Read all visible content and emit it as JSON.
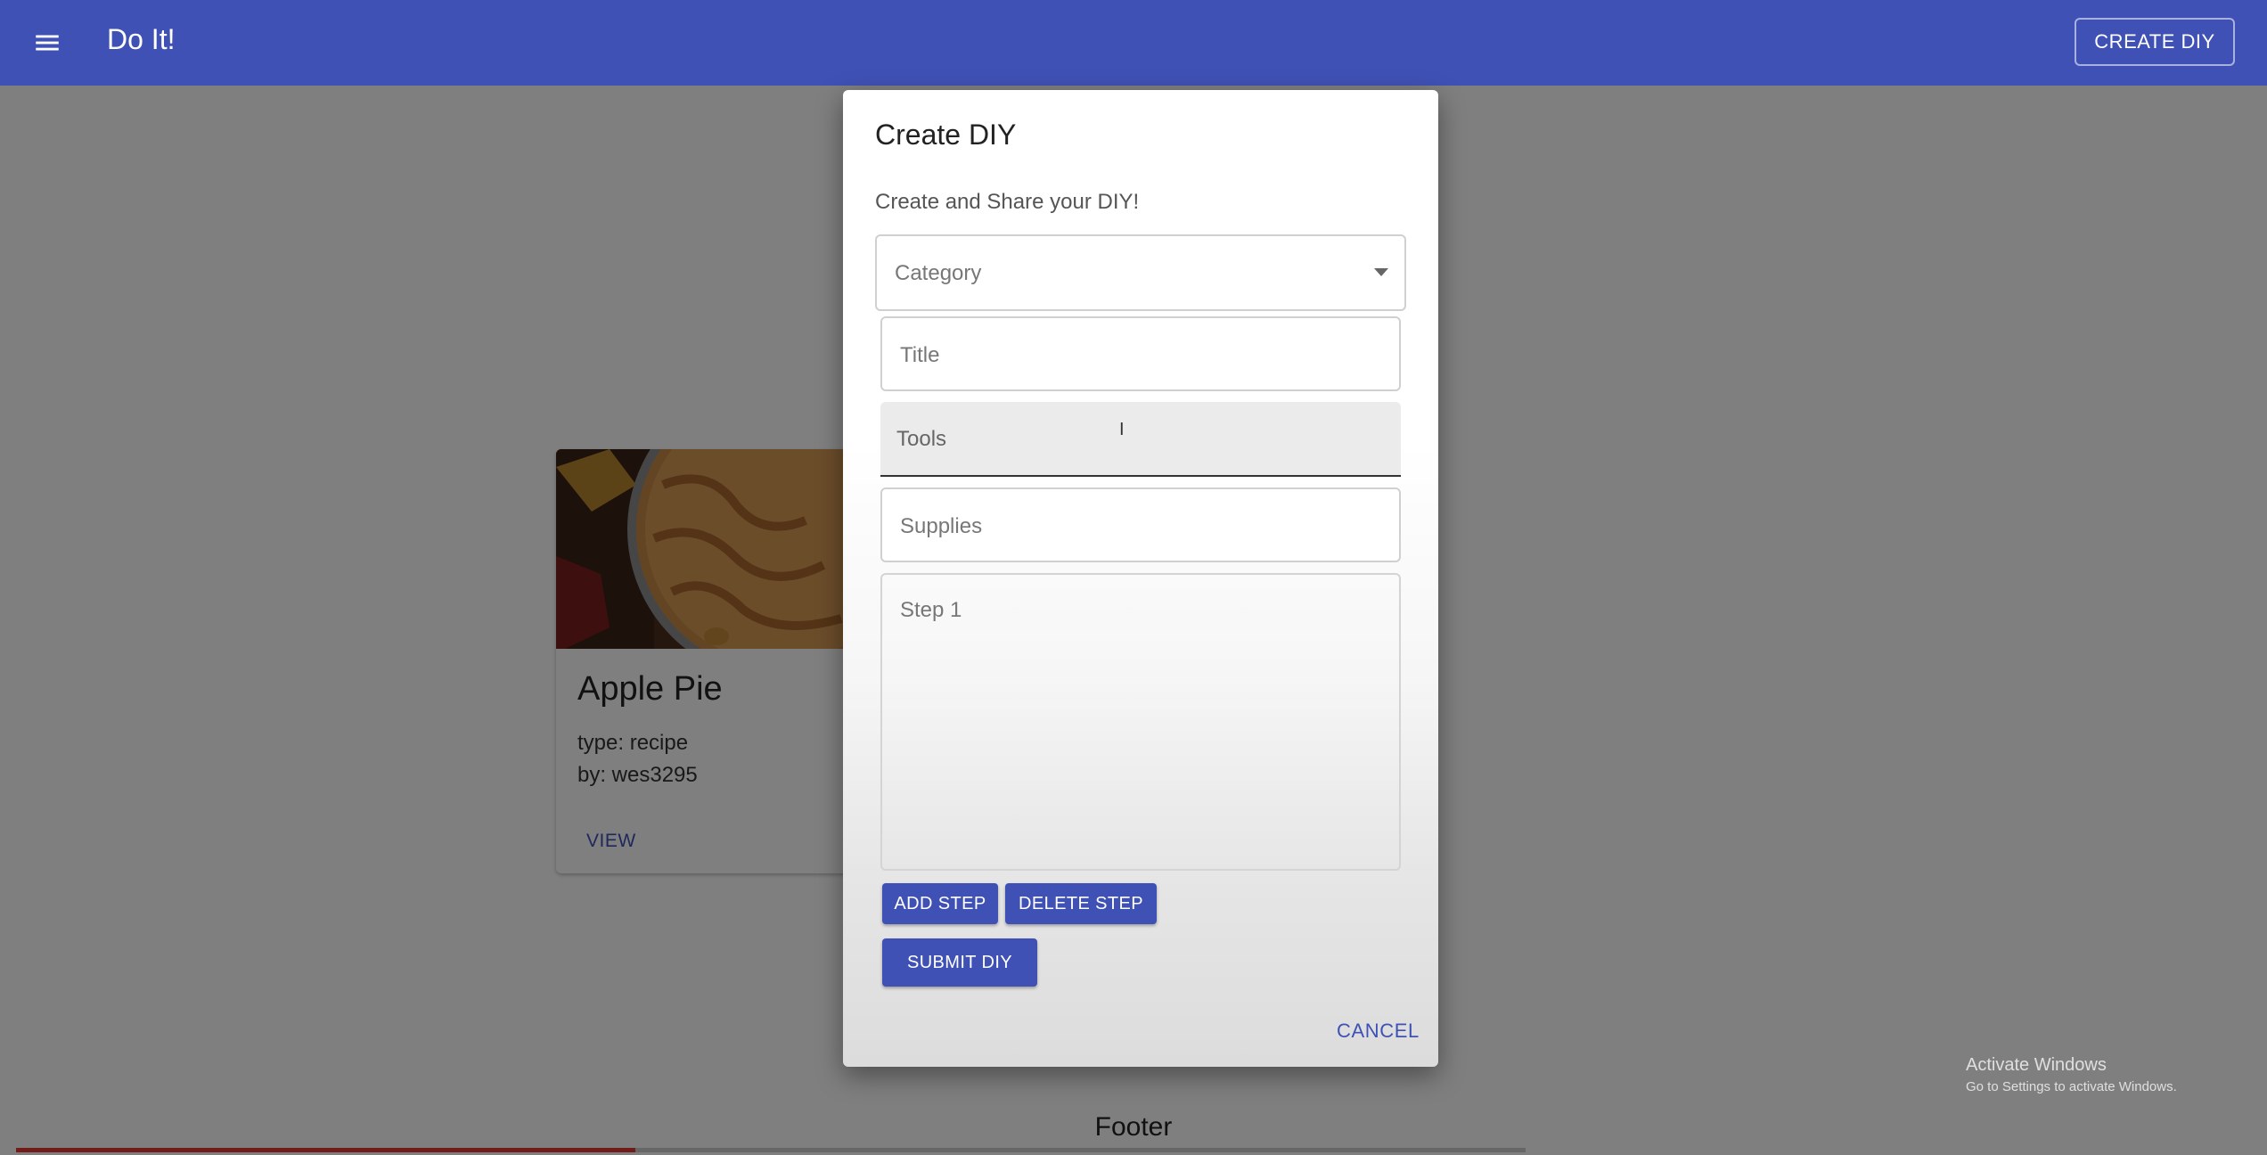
{
  "appbar": {
    "title": "Do It!",
    "create_label": "CREATE DIY",
    "color": "#3f51b5"
  },
  "card": {
    "title": "Apple Pie",
    "type": "type: recipe",
    "by": "by: wes3295",
    "view_label": "VIEW"
  },
  "footer": {
    "text": "Footer",
    "progress_percent": 41
  },
  "dialog": {
    "title": "Create DIY",
    "subtitle": "Create and Share your DIY!",
    "category_placeholder": "Category",
    "title_placeholder": "Title",
    "tools_placeholder": "Tools",
    "supplies_placeholder": "Supplies",
    "step_placeholder": "Step 1",
    "add_step_label": "ADD STEP",
    "delete_step_label": "DELETE STEP",
    "submit_label": "SUBMIT DIY",
    "cancel_label": "CANCEL"
  },
  "watermark": {
    "line1": "Activate Windows",
    "line2": "Go to Settings to activate Windows."
  }
}
